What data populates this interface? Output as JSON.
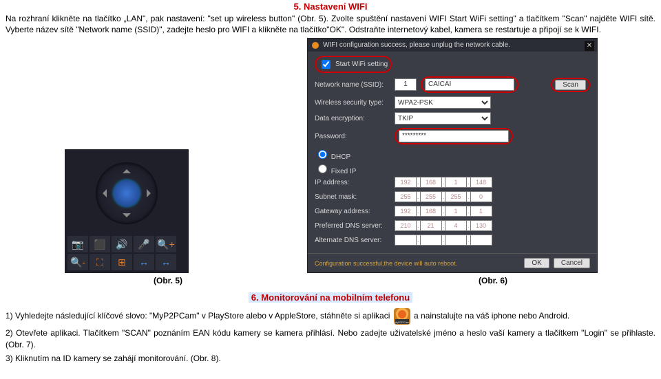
{
  "doc": {
    "sec5_title": "5. Nastavení WIFI",
    "sec5_para": "Na rozhraní klikněte na tlačítko „LAN\", pak nastavení: \"set up wireless button\" (Obr. 5). Zvolte spuštění nastavení WIFI Start WiFi setting\" a tlačítkem \"Scan\" najděte WIFI sítě. Vyberte název sítě \"Network name (SSID)\", zadejte heslo pro WIFI a klikněte na tlačítko\"OK\".   Odstraňte internetový kabel, kamera se restartuje a připojí se k WIFI.",
    "caption5": "(Obr. 5)",
    "caption6": "(Obr. 6)",
    "sec6_title": "6. Monitorování na mobilním telefonu",
    "sec6_p1a": "1) Vyhledejte následující klíčové slovo: \"MyP2PCam\" v PlayStore alebo v AppleStore, stáhněte si aplikaci ",
    "sec6_p1b": " a nainstalujte na váš iphone nebo Android.",
    "sec6_p2": "2) Otevřete aplikaci. Tlačítkem \"SCAN\" poznáním EAN kódu kamery se kamera přihlásí. Nebo zadejte uživatelské jméno a heslo vaší kamery a tlačítkem \"Login\" se přihlaste. (Obr. 7).",
    "sec6_p3": "3) Kliknutím na ID kamery se zahájí monitorování. (Obr. 8).",
    "app_icon_label": "MyP2PCam"
  },
  "panel": {
    "icons": [
      "📷",
      "⬛",
      "🔊",
      "🎤",
      "🔍+",
      "🔍-",
      "⛶",
      "⊞",
      "↔",
      "↔"
    ]
  },
  "cfg": {
    "banner": "WIFI configuration success, please unplug the network cable.",
    "start_wifi_label": "Start WiFi setting",
    "start_wifi_checked": true,
    "ssid_label": "Network name (SSID):",
    "ssid_value": "CAICAI",
    "scan_btn": "Scan",
    "sec_label": "Wireless security type:",
    "sec_value": "WPA2-PSK",
    "enc_label": "Data encryption:",
    "enc_value": "TKIP",
    "pw_label": "Password:",
    "pw_value": "*********",
    "dhcp_label": "DHCP",
    "fixed_label": "Fixed IP",
    "ip_label": "IP address:",
    "ip": [
      "192",
      "168",
      "1",
      "148"
    ],
    "subnet_label": "Subnet mask:",
    "subnet": [
      "255",
      "255",
      "255",
      "0"
    ],
    "gw_label": "Gateway address:",
    "gw": [
      "192",
      "168",
      "1",
      "1"
    ],
    "dns1_label": "Preferred DNS server:",
    "dns1": [
      "210",
      "21",
      "4",
      "130"
    ],
    "dns2_label": "Alternate DNS server:",
    "foot_msg": "Configuration successful,the device will auto reboot.",
    "ok_btn": "OK",
    "cancel_btn": "Cancel"
  }
}
